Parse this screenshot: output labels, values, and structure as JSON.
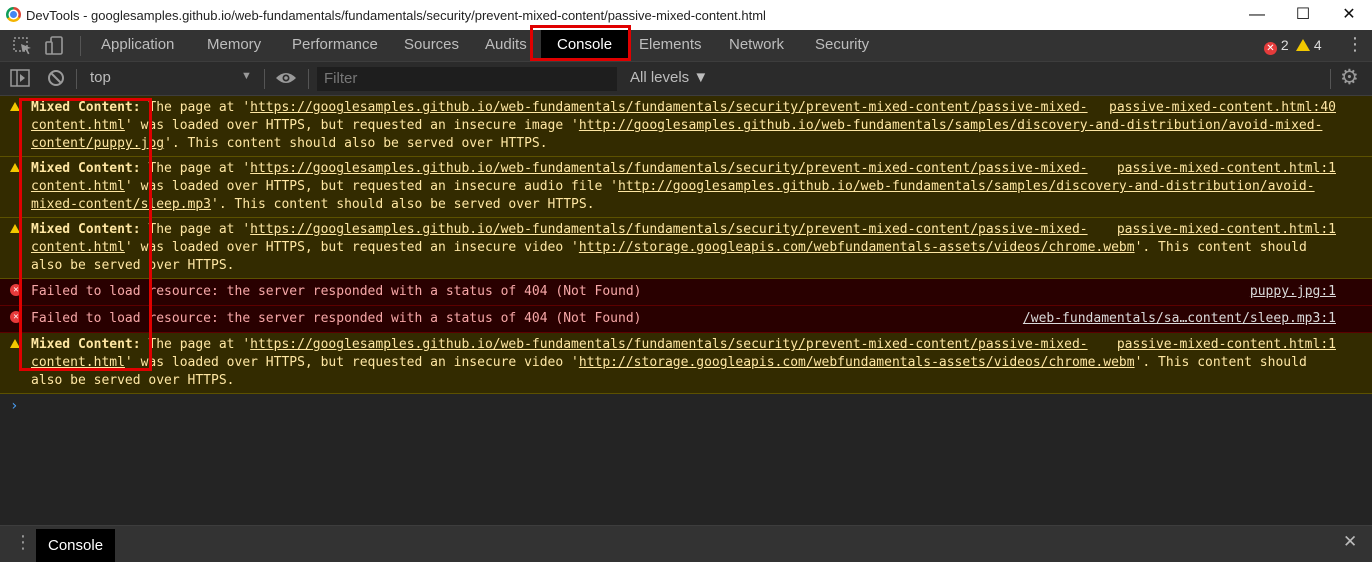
{
  "window": {
    "title": "DevTools - googlesamples.github.io/web-fundamentals/fundamentals/security/prevent-mixed-content/passive-mixed-content.html",
    "min_glyph": "—",
    "max_glyph": "☐",
    "close_glyph": "✕"
  },
  "tabs": [
    {
      "label": "Application"
    },
    {
      "label": "Memory"
    },
    {
      "label": "Performance"
    },
    {
      "label": "Sources"
    },
    {
      "label": "Audits"
    },
    {
      "label": "Console"
    },
    {
      "label": "Elements"
    },
    {
      "label": "Network"
    },
    {
      "label": "Security"
    }
  ],
  "counts": {
    "errors": "2",
    "warnings": "4",
    "error_glyph": "✕",
    "more_glyph": "⋮"
  },
  "toolbar": {
    "context": "top",
    "context_arrow": "▼",
    "filter_placeholder": "Filter",
    "levels": "All levels ▼",
    "settings_glyph": "⚙"
  },
  "messages": [
    {
      "level": "warning",
      "source": "passive-mixed-content.html:40",
      "prefix": "Mixed Content:",
      "t1": " The page at '",
      "link1": "https://googlesamples.github.io/web-fundamentals/fundamentals/security/prevent-mixed-content/passive-mixed-content.html",
      "t2": "' was loaded over HTTPS, but requested an insecure image '",
      "link2": "http://googlesamples.github.io/web-fundamentals/samples/discovery-and-distribution/avoid-mixed-content/puppy.jpg",
      "t3": "'. This content should also be served over HTTPS."
    },
    {
      "level": "warning",
      "source": "passive-mixed-content.html:1",
      "prefix": "Mixed Content:",
      "t1": " The page at '",
      "link1": "https://googlesamples.github.io/web-fundamentals/fundamentals/security/prevent-mixed-content/passive-mixed-content.html",
      "t2": "' was loaded over HTTPS, but requested an insecure audio file '",
      "link2": "http://googlesamples.github.io/web-fundamentals/samples/discovery-and-distribution/avoid-mixed-content/sleep.mp3",
      "t3": "'. This content should also be served over HTTPS."
    },
    {
      "level": "warning",
      "source": "passive-mixed-content.html:1",
      "prefix": "Mixed Content:",
      "t1": " The page at '",
      "link1": "https://googlesamples.github.io/web-fundamentals/fundamentals/security/prevent-mixed-content/passive-mixed-content.html",
      "t2": "' was loaded over HTTPS, but requested an insecure video '",
      "link2": "http://storage.googleapis.com/webfundamentals-assets/videos/chrome.webm",
      "t3": "'. This content should also be served over HTTPS."
    },
    {
      "level": "error",
      "source": "puppy.jpg:1",
      "text": "Failed to load resource: the server responded with a status of 404 (Not Found)"
    },
    {
      "level": "error",
      "source": "/web-fundamentals/sa…content/sleep.mp3:1",
      "text": "Failed to load resource: the server responded with a status of 404 (Not Found)"
    },
    {
      "level": "warning",
      "source": "passive-mixed-content.html:1",
      "prefix": "Mixed Content:",
      "t1": " The page at '",
      "link1": "https://googlesamples.github.io/web-fundamentals/fundamentals/security/prevent-mixed-content/passive-mixed-content.html",
      "t2": "' was loaded over HTTPS, but requested an insecure video '",
      "link2": "http://storage.googleapis.com/webfundamentals-assets/videos/chrome.webm",
      "t3": "'. This content should also be served over HTTPS."
    }
  ],
  "prompt": "›",
  "drawer": {
    "tab": "Console",
    "menu_glyph": "⋮",
    "close_glyph": "✕"
  }
}
